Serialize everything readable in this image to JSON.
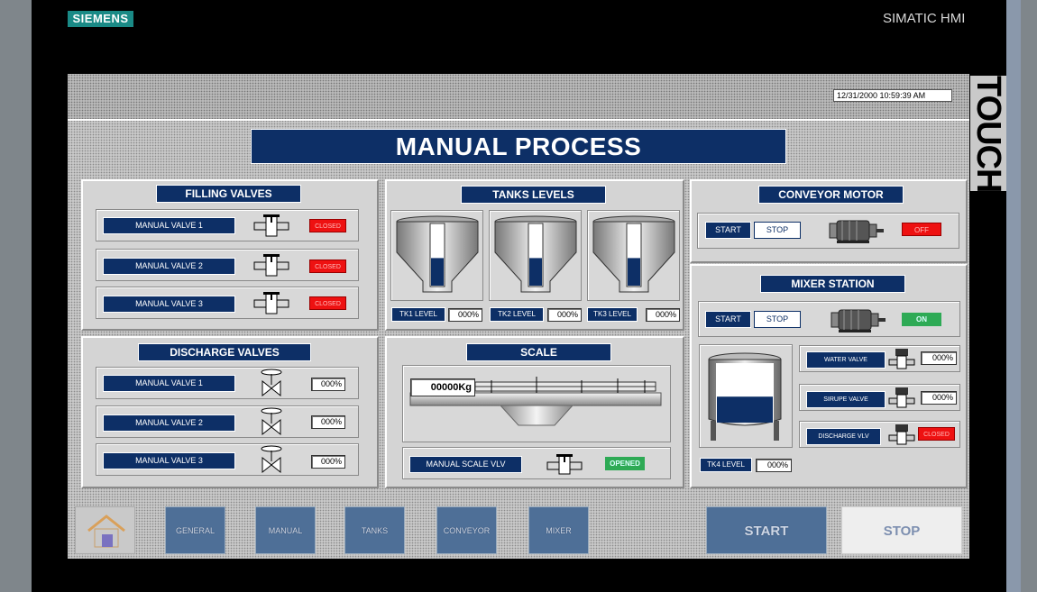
{
  "device": {
    "logo": "SIEMENS",
    "brand": "SIMATIC HMI",
    "touch_label": "TOUCH"
  },
  "header": {
    "datetime": "12/31/2000 10:59:39 AM",
    "title": "MANUAL PROCESS"
  },
  "filling_valves": {
    "title": "FILLING VALVES",
    "rows": [
      {
        "label": "MANUAL VALVE 1",
        "status": "CLOSED"
      },
      {
        "label": "MANUAL VALVE 2",
        "status": "CLOSED"
      },
      {
        "label": "MANUAL VALVE 3",
        "status": "CLOSED"
      }
    ]
  },
  "discharge_valves": {
    "title": "DISCHARGE VALVES",
    "rows": [
      {
        "label": "MANUAL VALVE 1",
        "value": "000%"
      },
      {
        "label": "MANUAL VALVE 2",
        "value": "000%"
      },
      {
        "label": "MANUAL VALVE 3",
        "value": "000%"
      }
    ]
  },
  "tanks_levels": {
    "title": "TANKS LEVELS",
    "tanks": [
      {
        "label": "TK1 LEVEL",
        "value": "000%",
        "fill": 0.45
      },
      {
        "label": "TK2 LEVEL",
        "value": "000%",
        "fill": 0.45
      },
      {
        "label": "TK3 LEVEL",
        "value": "000%",
        "fill": 0.45
      }
    ]
  },
  "scale": {
    "title": "SCALE",
    "weight": "00000Kg",
    "valve_label": "MANUAL SCALE VLV",
    "valve_status": "OPENED"
  },
  "conveyor_motor": {
    "title": "CONVEYOR MOTOR",
    "start": "START",
    "stop": "STOP",
    "status": "OFF"
  },
  "mixer_station": {
    "title": "MIXER STATION",
    "start": "START",
    "stop": "STOP",
    "status": "ON",
    "tank_fill": 0.45,
    "valves": [
      {
        "label": "WATER VALVE",
        "value": "000%"
      },
      {
        "label": "SIRUPE VALVE",
        "value": "000%"
      },
      {
        "label": "DISCHARGE VLV",
        "status": "CLOSED"
      }
    ],
    "tk4_label": "TK4 LEVEL",
    "tk4_value": "000%"
  },
  "nav": {
    "items": [
      "GENERAL",
      "MANUAL",
      "TANKS",
      "CONVEYOR",
      "MIXER"
    ],
    "start": "START",
    "stop": "STOP"
  },
  "colors": {
    "navy": "#0d2f66",
    "red": "#ee1111",
    "green": "#2eaa55"
  }
}
